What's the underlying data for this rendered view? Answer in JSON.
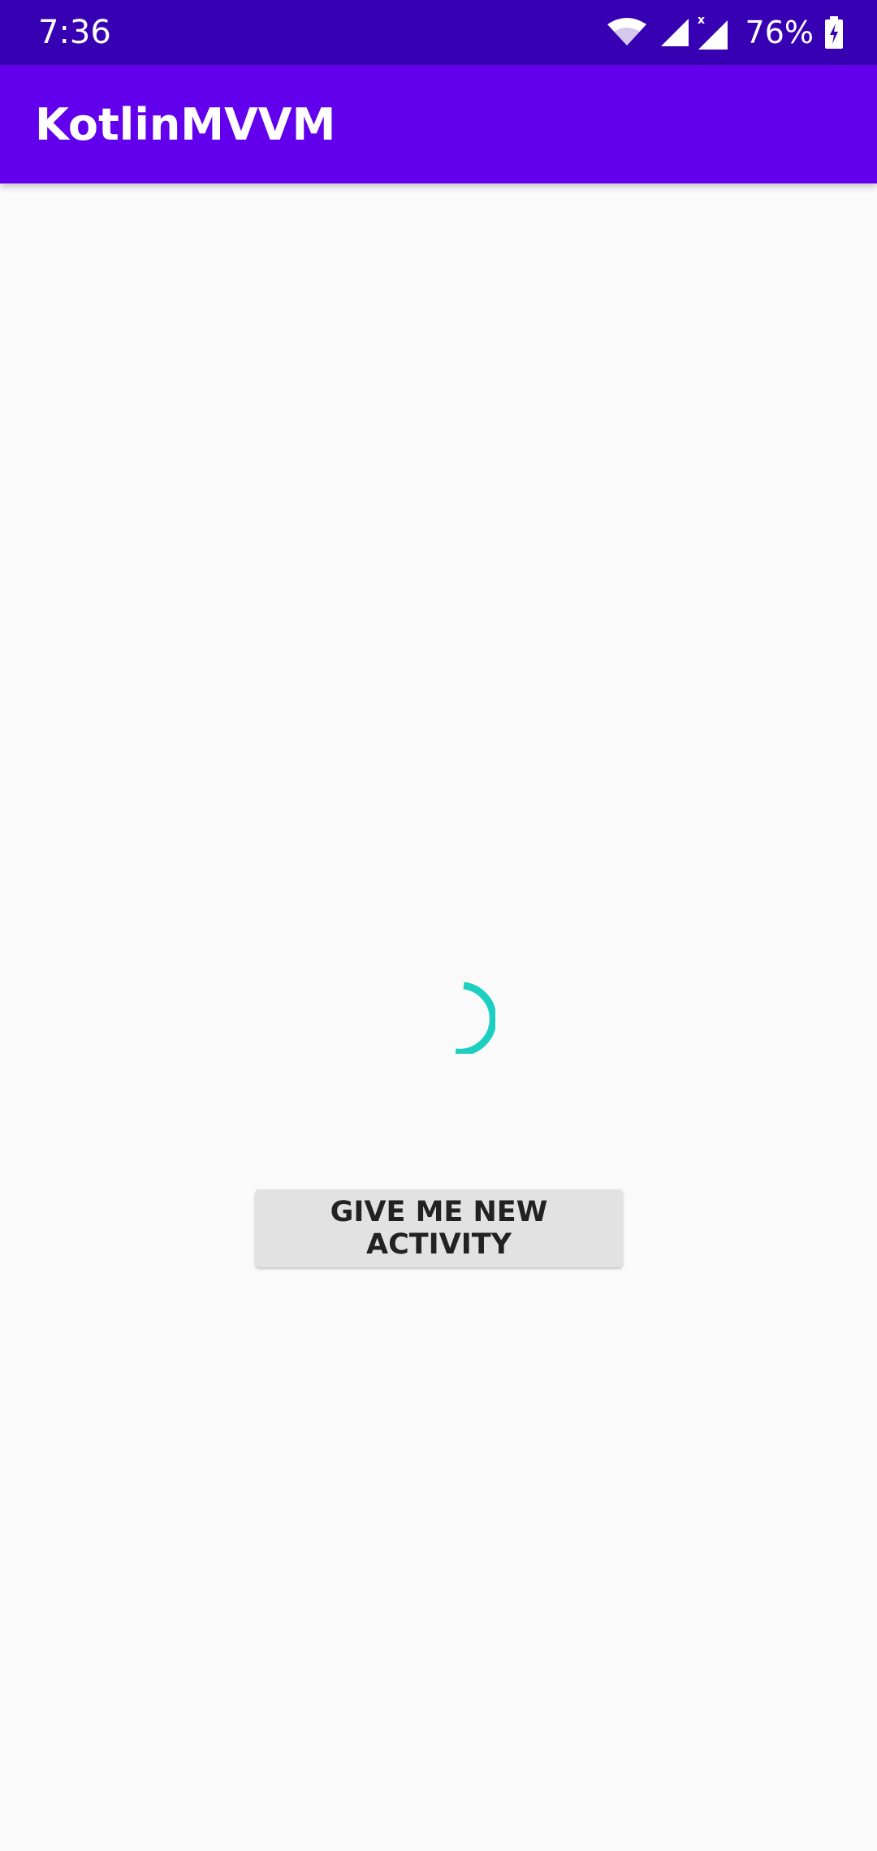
{
  "status_bar": {
    "time": "7:36",
    "battery_percent": "76%",
    "icons": [
      "wifi-icon",
      "signal-icon",
      "signal-no-data-icon",
      "battery-charging-icon"
    ],
    "mobile_data_badge": "x"
  },
  "app_bar": {
    "title": "KotlinMVVM"
  },
  "main": {
    "loading_indicator": "progress-spinner-icon",
    "button_label": "GIVE ME NEW ACTIVITY"
  },
  "colors": {
    "status_bar": "#3700b3",
    "app_bar": "#6200ee",
    "spinner": "#1ccfc0",
    "background": "#fafafa",
    "button": "#e2e2e2"
  }
}
